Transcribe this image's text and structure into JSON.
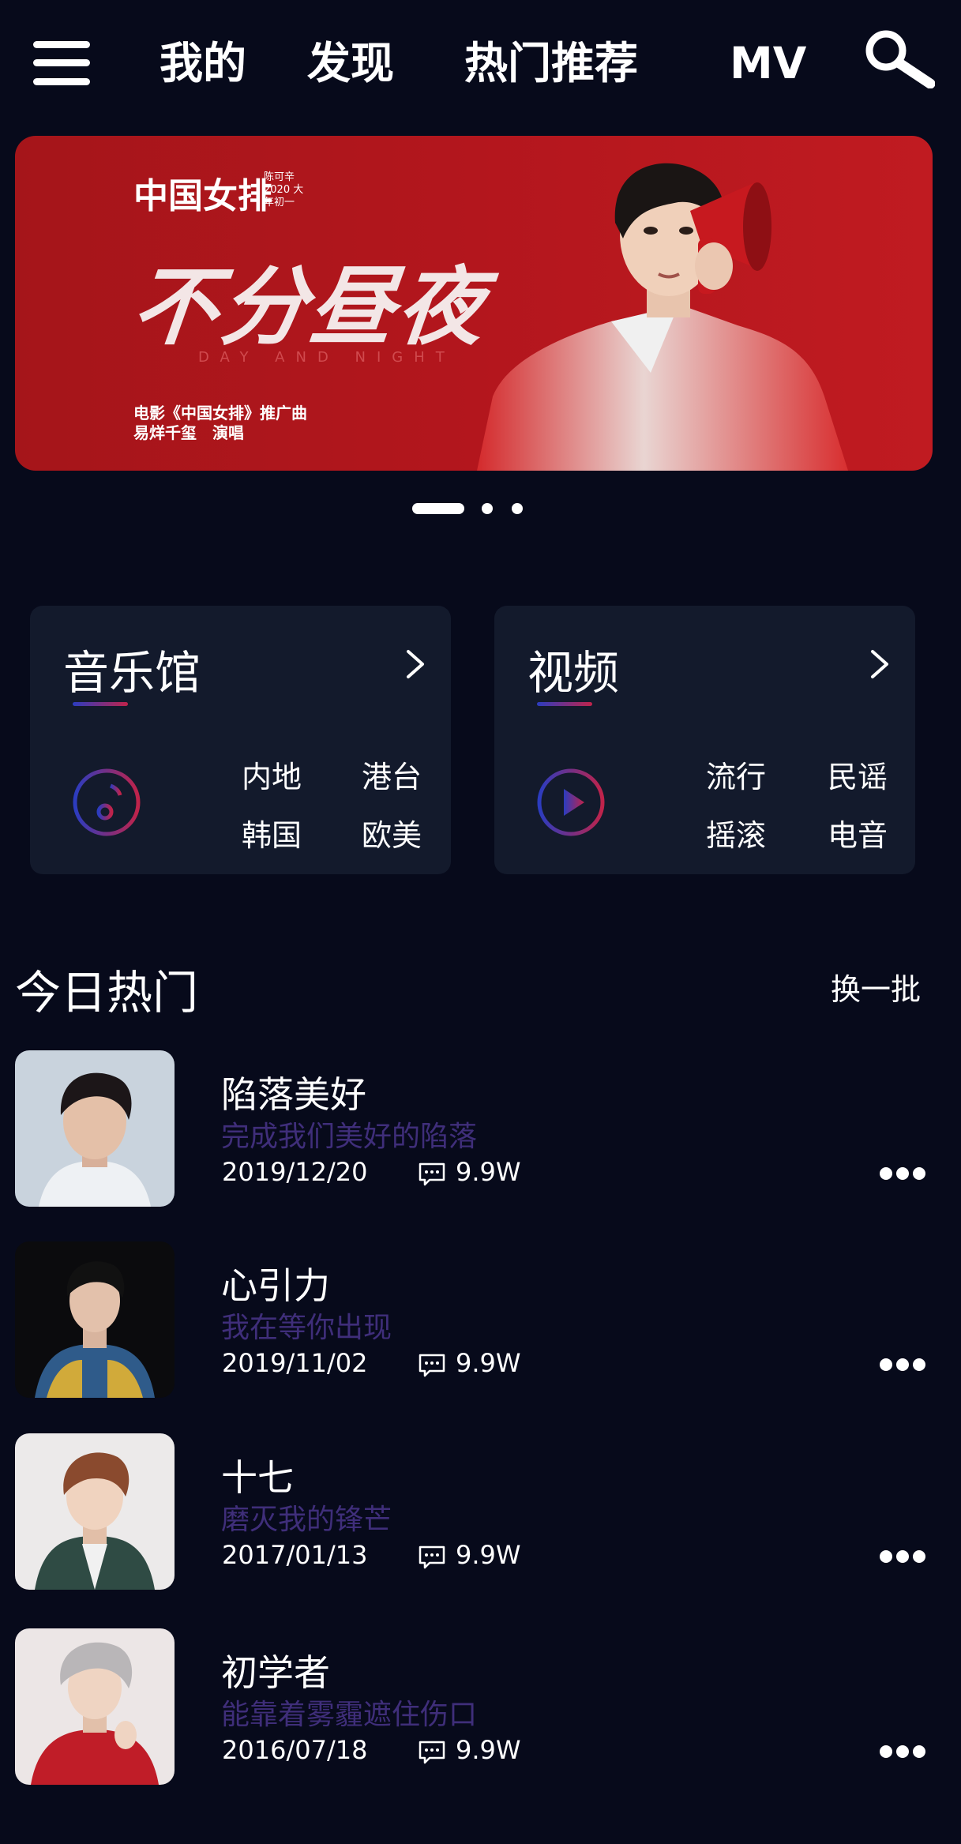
{
  "nav": {
    "tabs": [
      "我的",
      "发现",
      "热门推荐",
      "MV"
    ],
    "menu_icon": "hamburger-menu-icon",
    "search_icon": "search-icon"
  },
  "banner": {
    "brand": "中国女排",
    "brand_sub": "陈可辛 2020 大年初一",
    "title": "不分昼夜",
    "title_en": "DAY AND NIGHT",
    "caption_line1": "电影《中国女排》推广曲",
    "caption_line2": "易烊千玺　演唱",
    "active_slide": 1,
    "slide_count": 3
  },
  "cards": [
    {
      "title": "音乐馆",
      "icon": "music-disc-icon",
      "categories": [
        "内地",
        "港台",
        "韩国",
        "欧美"
      ]
    },
    {
      "title": "视频",
      "icon": "play-circle-icon",
      "categories": [
        "流行",
        "民谣",
        "摇滚",
        "电音"
      ]
    }
  ],
  "hot": {
    "title": "今日热门",
    "refresh_label": "换一批",
    "songs": [
      {
        "title": "陷落美好",
        "subtitle": "完成我们美好的陷落",
        "date": "2019/12/20",
        "comments": "9.9W"
      },
      {
        "title": "心引力",
        "subtitle": "我在等你出现",
        "date": "2019/11/02",
        "comments": "9.9W"
      },
      {
        "title": "十七",
        "subtitle": "磨灭我的锋芒",
        "date": "2017/01/13",
        "comments": "9.9W"
      },
      {
        "title": "初学者",
        "subtitle": "能靠着雾霾遮住伤口",
        "date": "2016/07/18",
        "comments": "9.9W"
      }
    ]
  },
  "colors": {
    "background": "#070a1b",
    "card": "#131a2c",
    "banner_red": "#b3161d",
    "subtitle_purple": "#3f2e7a",
    "accent_blue": "#2b3cc0",
    "accent_red": "#c0234a"
  }
}
